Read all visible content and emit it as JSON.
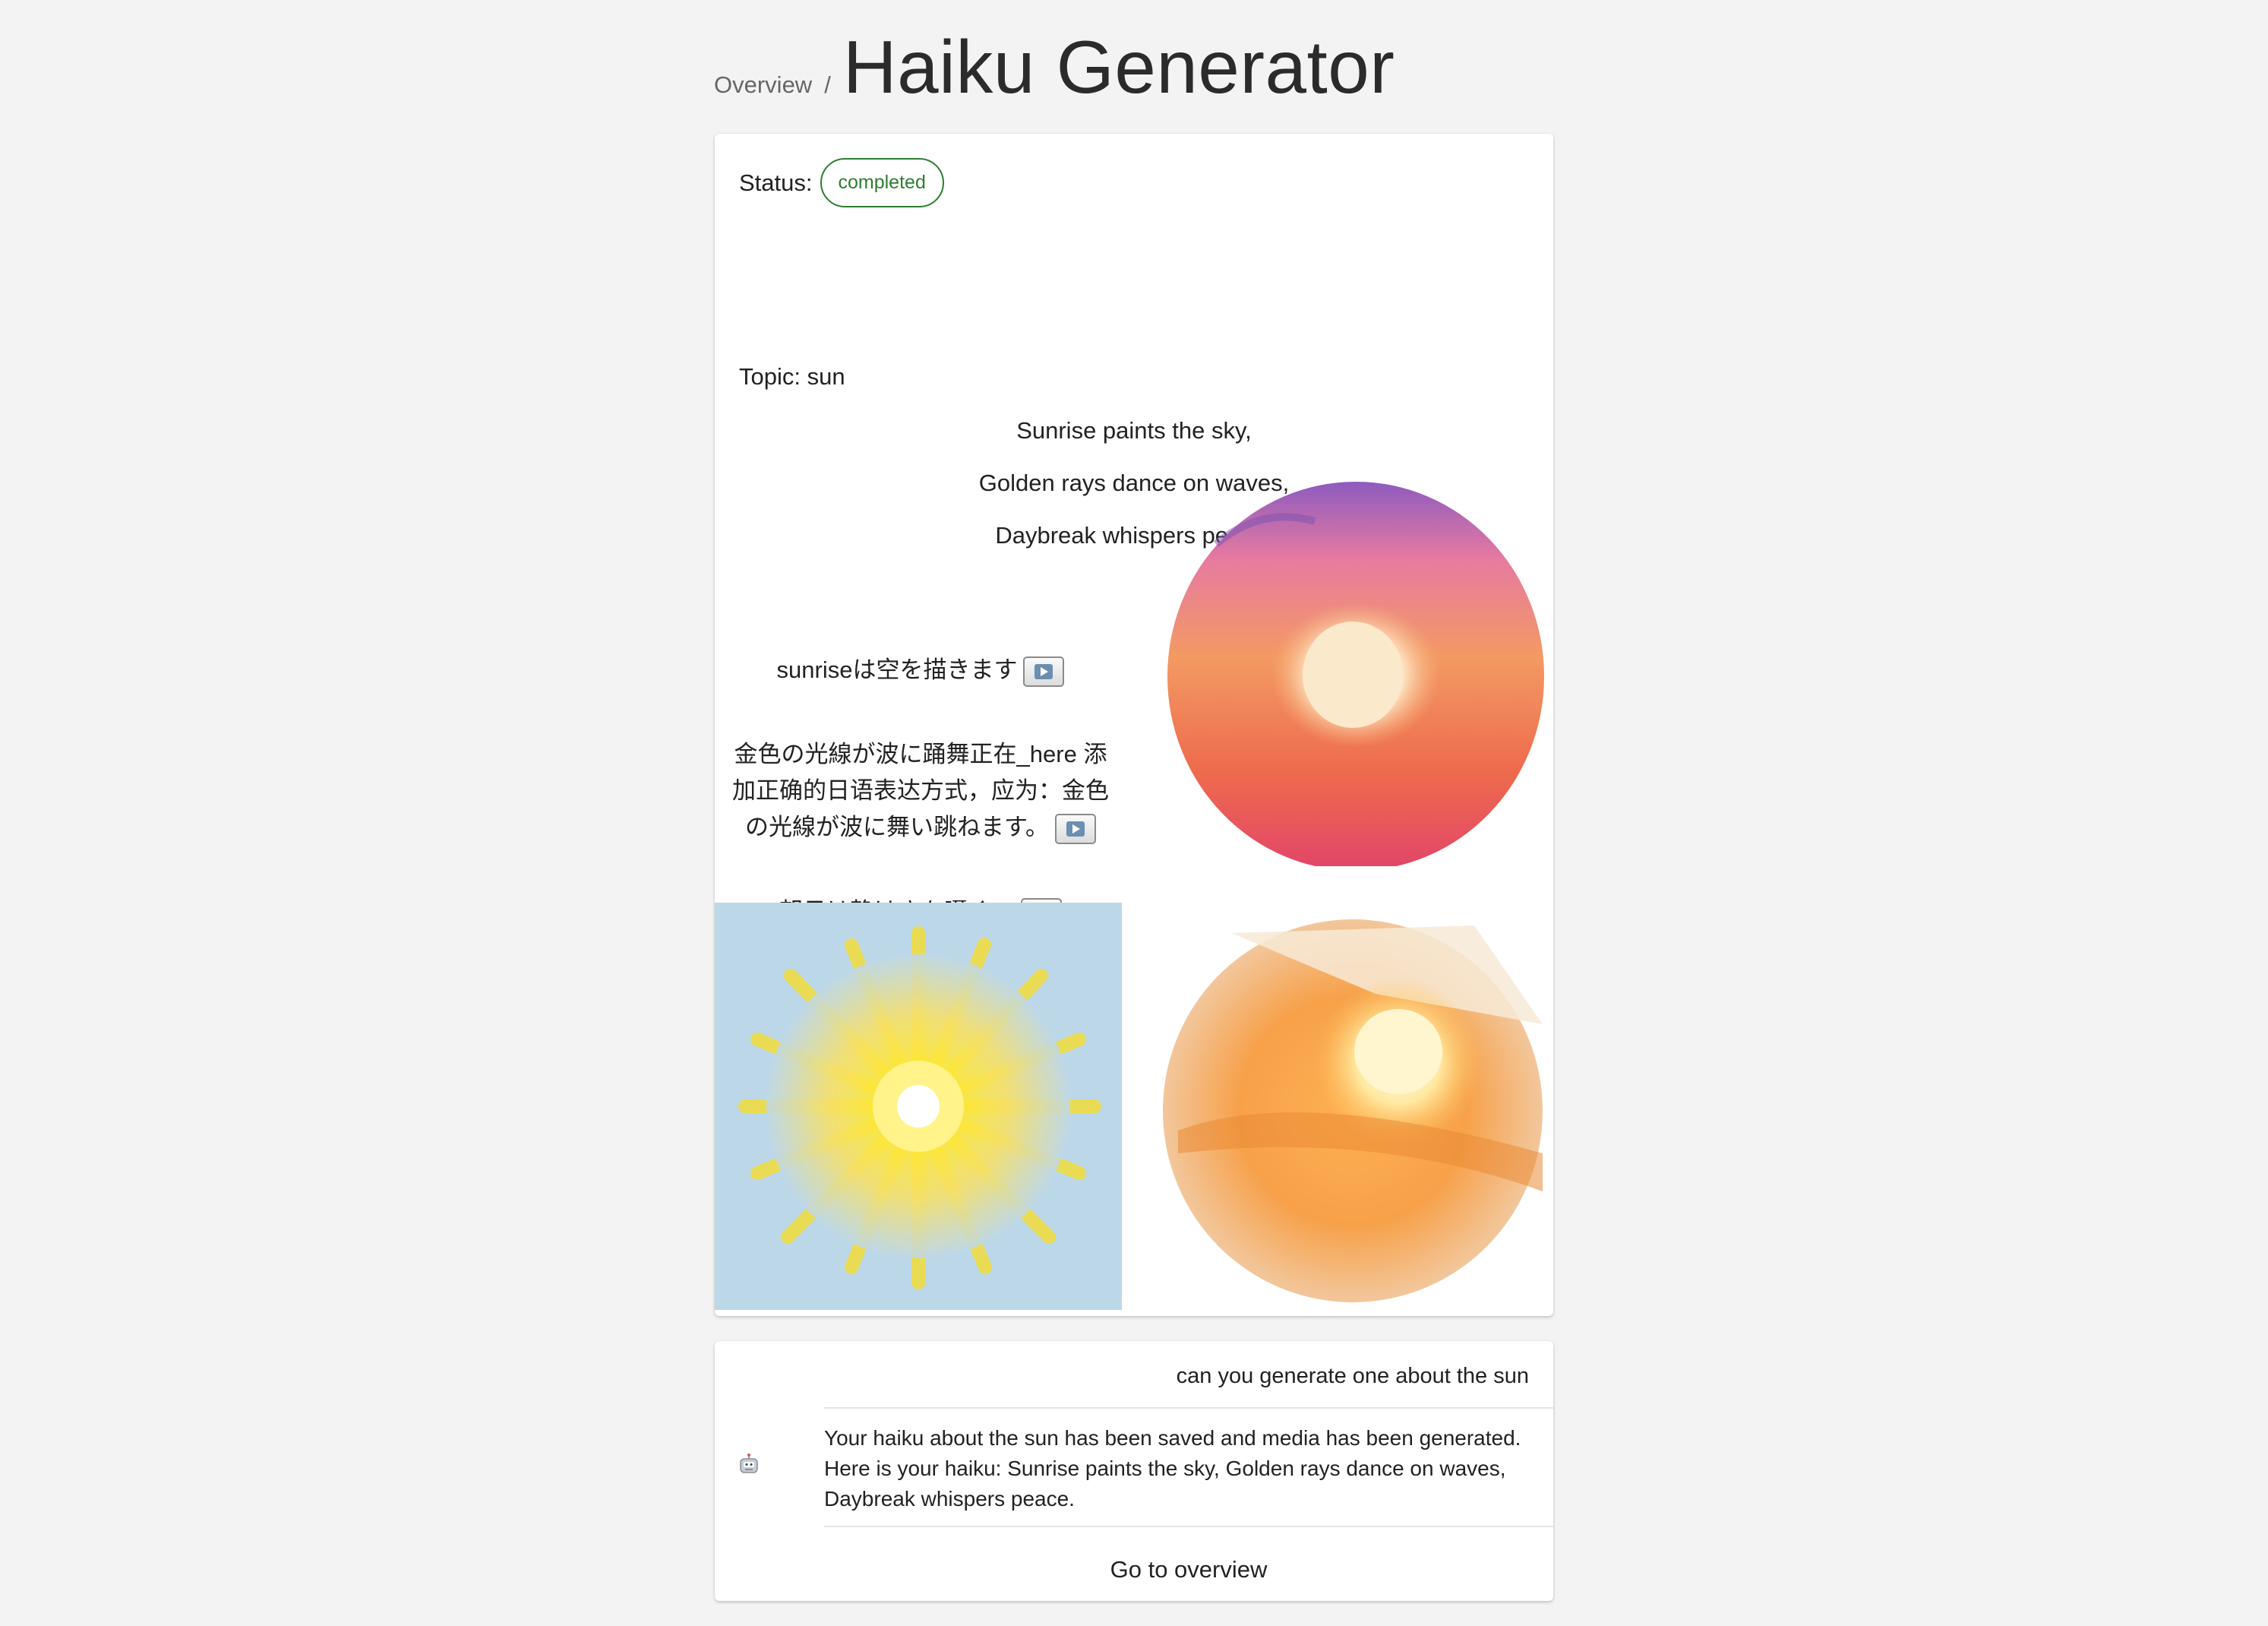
{
  "breadcrumb": {
    "link": "Overview",
    "separator": "/"
  },
  "page": {
    "title": "Haiku Generator"
  },
  "status": {
    "label": "Status:",
    "value": "completed",
    "color": "#2e7d32"
  },
  "topic": {
    "label": "Topic: sun"
  },
  "haiku": {
    "lines": [
      "Sunrise paints the sky,",
      "Golden rays dance on waves,",
      "Daybreak whispers peace."
    ]
  },
  "translations": [
    {
      "text": "sunriseは空を描きます",
      "button_icon": "play-icon"
    },
    {
      "text": "金色の光線が波に踊舞正在_here 添加正确的日语表达方式，应为：金色の光線が波に舞い跳ねます。",
      "button_icon": "play-icon"
    },
    {
      "text": "朝日は静けさを囁く。",
      "button_icon": "play-icon"
    }
  ],
  "images": [
    {
      "name": "sunrise-sphere-image"
    },
    {
      "name": "yellow-sun-burst-image"
    },
    {
      "name": "orange-sun-globe-image"
    }
  ],
  "chat": {
    "user_message": "can you generate one about the sun",
    "bot_icon": "robot-icon",
    "bot_message": "Your haiku about the sun has been saved and media has been generated. Here is your haiku: Sunrise paints the sky, Golden rays dance on waves, Daybreak whispers peace.",
    "action_label": "Go to overview"
  }
}
